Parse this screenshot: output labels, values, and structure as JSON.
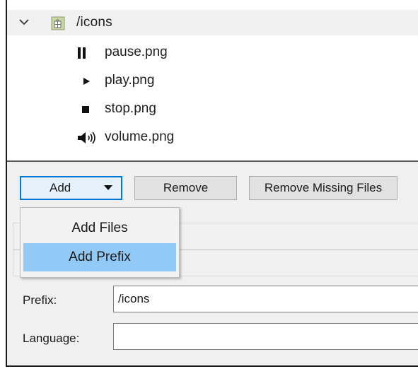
{
  "tree": {
    "root": {
      "label": "/icons",
      "expanded": true
    },
    "items": [
      {
        "label": "pause.png",
        "icon": "pause-icon"
      },
      {
        "label": "play.png",
        "icon": "play-icon"
      },
      {
        "label": "stop.png",
        "icon": "stop-icon"
      },
      {
        "label": "volume.png",
        "icon": "volume-icon"
      }
    ]
  },
  "toolbar": {
    "add_label": "Add",
    "remove_label": "Remove",
    "remove_missing_label": "Remove Missing Files"
  },
  "add_menu": {
    "items": [
      {
        "label": "Add Files",
        "highlighted": false
      },
      {
        "label": "Add Prefix",
        "highlighted": true
      }
    ]
  },
  "properties": {
    "prefix_label": "Prefix:",
    "prefix_value": "/icons",
    "language_label": "Language:",
    "language_value": ""
  },
  "colors": {
    "highlight": "#91c9f7",
    "focus_border": "#0078d7",
    "root_row_bg": "#f1f1f1"
  }
}
